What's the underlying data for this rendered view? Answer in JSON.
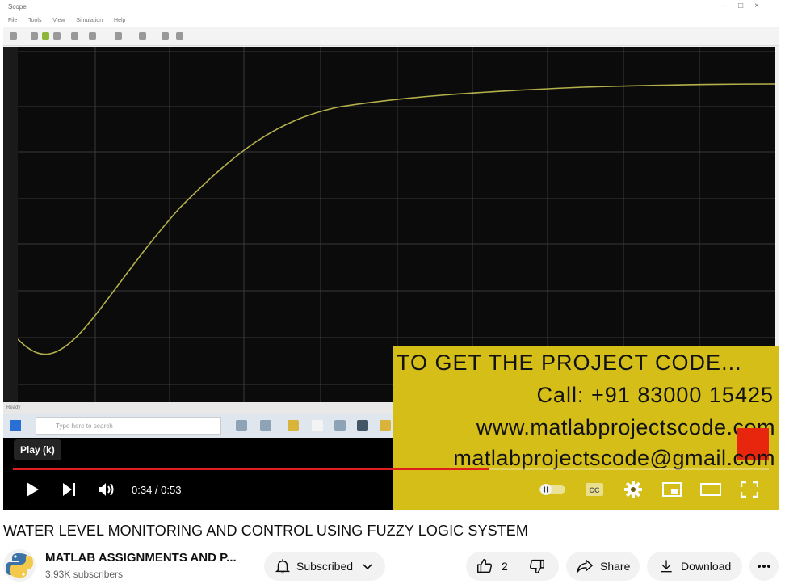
{
  "video_frame": {
    "window_title": "Scope",
    "menu_items": [
      "File",
      "Tools",
      "View",
      "Simulation",
      "Help"
    ],
    "status_text": "Ready",
    "taskbar_search_placeholder": "Type here to search"
  },
  "ad_overlay": {
    "line1": "TO GET THE PROJECT CODE...",
    "line2": "Call: +91 83000 15425",
    "line3": "www.matlabprojectscode.com",
    "line4": "matlabprojectscode@gmail.com"
  },
  "player": {
    "tooltip": "Play (k)",
    "current_time": "0:34",
    "duration": "0:53",
    "time_display": "0:34 / 0:53",
    "progress_fraction": 0.63,
    "progress_color": "#e01e1e"
  },
  "video": {
    "title": "WATER LEVEL MONITORING AND CONTROL USING FUZZY LOGIC SYSTEM"
  },
  "channel": {
    "name": "MATLAB ASSIGNMENTS AND P...",
    "subscribers": "3.93K subscribers"
  },
  "actions": {
    "subscribed_label": "Subscribed",
    "like_count": "2",
    "share_label": "Share",
    "download_label": "Download"
  },
  "icons": [
    "play-icon",
    "next-icon",
    "volume-icon",
    "autoplay-toggle-icon",
    "captions-icon",
    "settings-icon",
    "miniplayer-icon",
    "theater-icon",
    "fullscreen-icon",
    "bell-icon",
    "chevron-down-icon",
    "like-icon",
    "dislike-icon",
    "share-icon",
    "download-icon",
    "more-icon"
  ]
}
